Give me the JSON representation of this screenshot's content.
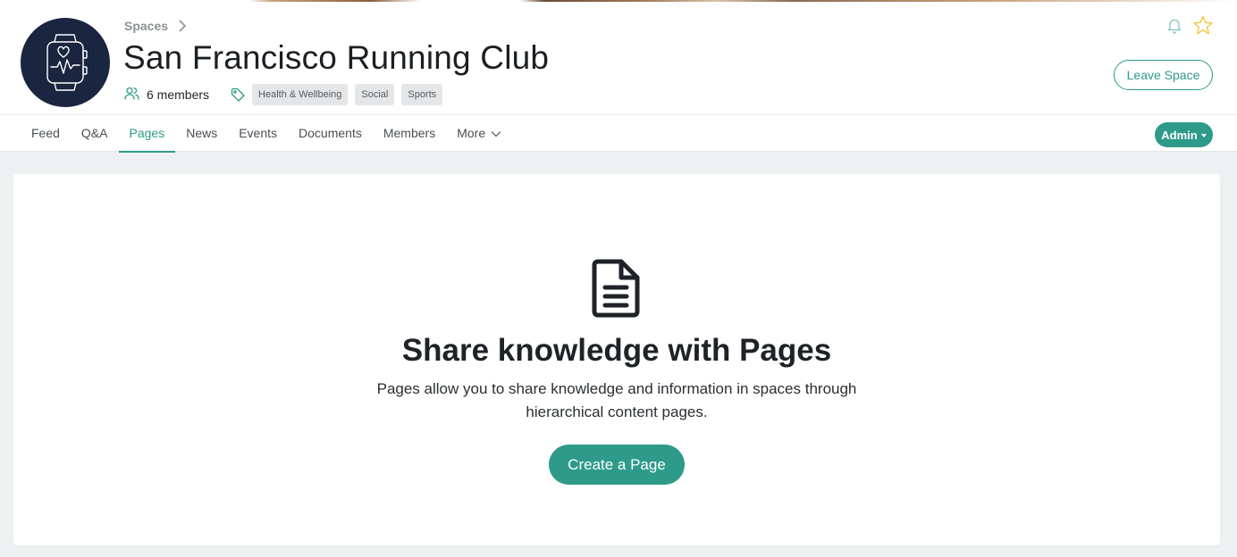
{
  "breadcrumb": {
    "label": "Spaces"
  },
  "space": {
    "title": "San Francisco Running Club",
    "members_label": "6 members",
    "tags": [
      "Health & Wellbeing",
      "Social",
      "Sports"
    ]
  },
  "actions": {
    "leave_label": "Leave Space"
  },
  "nav": {
    "items": [
      "Feed",
      "Q&A",
      "Pages",
      "News",
      "Events",
      "Documents",
      "Members",
      "More"
    ],
    "active": "Pages",
    "admin_label": "Admin"
  },
  "empty_state": {
    "title": "Share knowledge with Pages",
    "description": "Pages allow you to share knowledge and information in spaces through hierarchical content pages.",
    "button_label": "Create a Page"
  },
  "icons": {
    "avatar": "smartwatch-heart-icon",
    "breadcrumb_separator": "chevron-right-icon",
    "members": "users-icon",
    "tags": "tag-icon",
    "notifications": "bell-icon",
    "favorite": "star-icon",
    "more": "chevron-down-icon",
    "empty_state": "document-icon"
  },
  "colors": {
    "accent": "#2e9a8a",
    "avatar_bg": "#1a2540",
    "favorite": "#f2c94c"
  }
}
